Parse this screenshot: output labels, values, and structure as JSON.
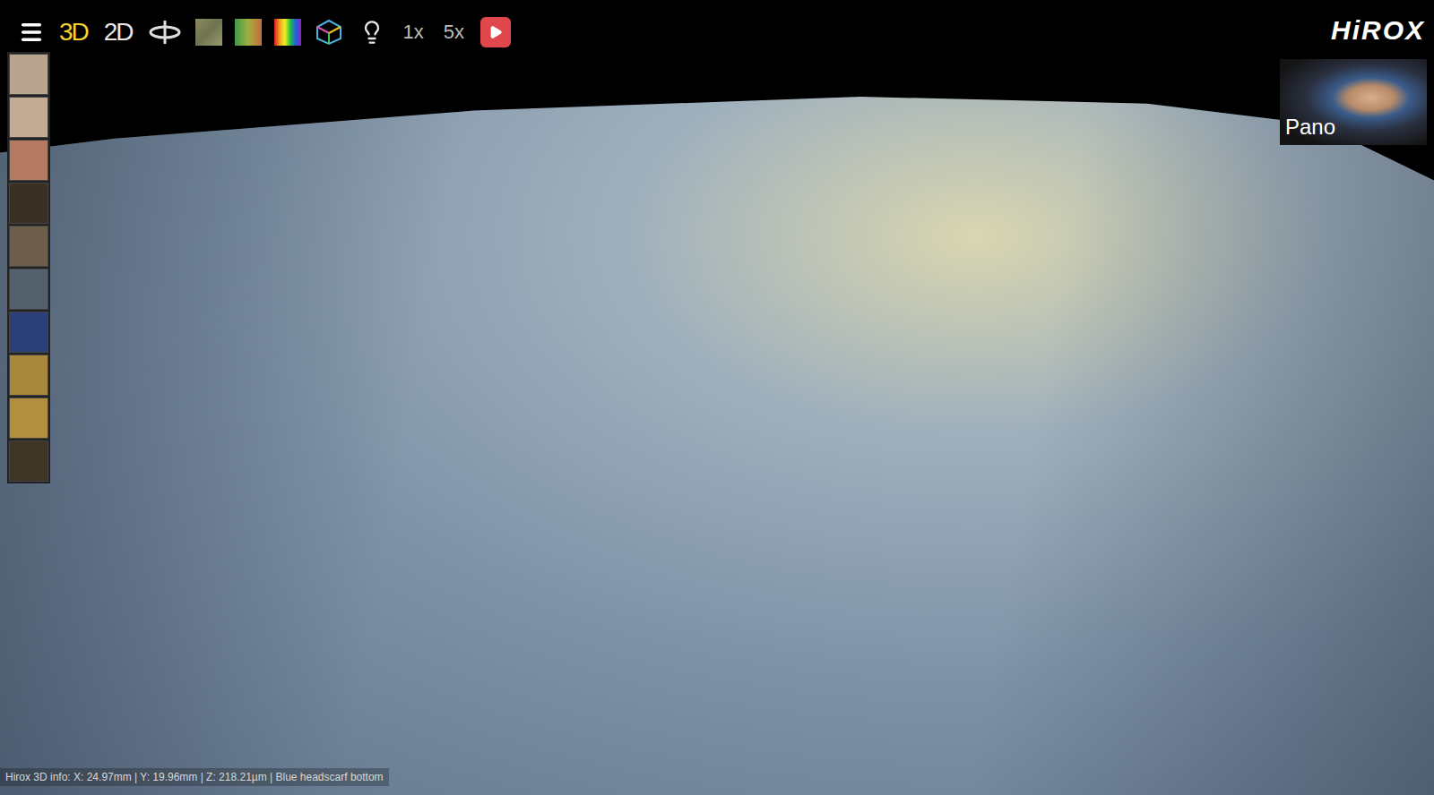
{
  "toolbar": {
    "modes": [
      {
        "label": "3D",
        "selected": true
      },
      {
        "label": "2D",
        "selected": false
      }
    ],
    "zoom": [
      {
        "label": "1x"
      },
      {
        "label": "5x"
      }
    ]
  },
  "logo": {
    "text": "HiROX"
  },
  "pano": {
    "label": "Pano"
  },
  "thumbnails": [
    {
      "color": "#b9a58f"
    },
    {
      "color": "#c2ab95"
    },
    {
      "color": "#b57a62"
    },
    {
      "color": "#3a3026"
    },
    {
      "color": "#6e5e4c"
    },
    {
      "color": "#54606c"
    },
    {
      "color": "#2b3f78"
    },
    {
      "color": "#a8893c"
    },
    {
      "color": "#b08f3e"
    },
    {
      "color": "#3f3526"
    }
  ],
  "info": {
    "text": "Hirox 3D info: X: 24.97mm | Y: 19.96mm | Z: 218.21µm | Blue headscarf bottom"
  }
}
